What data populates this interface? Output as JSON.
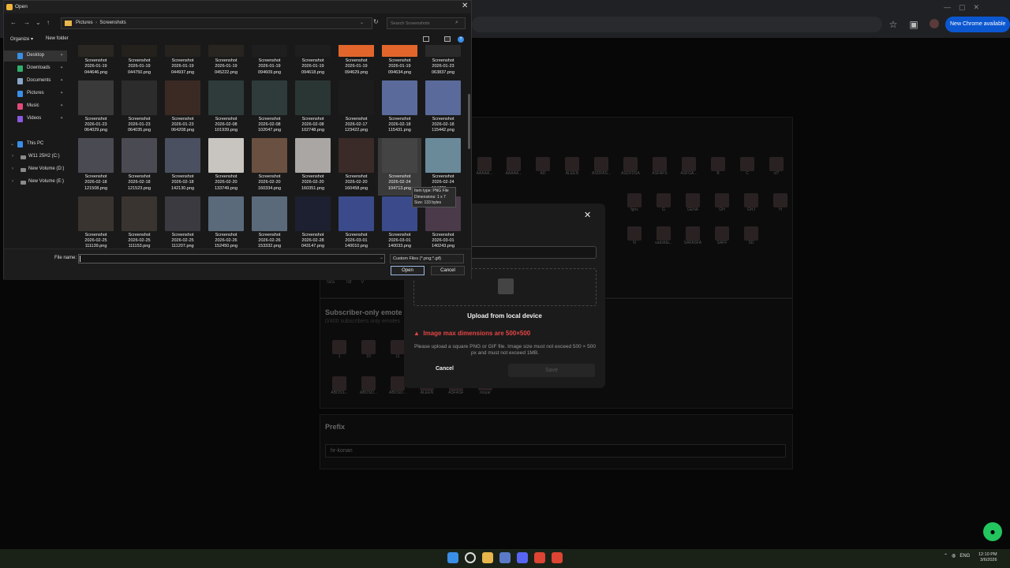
{
  "browser": {
    "new_chrome_label": "New Chrome available"
  },
  "page": {
    "subscriber_title": "Subscriber-only emote",
    "subscriber_note": "0/400 subscribers only emotes",
    "prefix_title": "Prefix",
    "prefix_value": "hr-konan",
    "emote_labels_row1": [
      "AAAAA...",
      "AAAAA...",
      "AD",
      "ALEEN",
      "ASDFAS...",
      "ASDFDSA",
      "ASFAFS",
      "ASFGA...",
      "B",
      "C",
      "cf7"
    ],
    "emote_labels_row2": [
      "fghs",
      "G",
      "GENA",
      "GH",
      "GHJ",
      "H"
    ],
    "emote_labels_row3": [
      "N",
      "sadsfda...",
      "SAFASFA",
      "SAFF",
      "SD"
    ],
    "emote_labels_row4": [
      "1",
      "10",
      "11",
      "3",
      "4",
      "5",
      "6",
      "7",
      "8"
    ],
    "emote_labels_row5": [
      "ABOSS...",
      "ABOSO...",
      "ABOSO...",
      "ALEEN",
      "ASFASF",
      "moyar"
    ],
    "partial_labels": [
      "fafa",
      "fdf",
      "V"
    ]
  },
  "modal": {
    "upload_title": "Upload from local device",
    "warning": "Image max dimensions are 500×500",
    "note": "Please upload a square PNG or GIF file. Image size must not exceed 500 × 500 px and must not exceed 1MB.",
    "cancel": "Cancel",
    "save": "Save"
  },
  "dialog": {
    "title": "Open",
    "path": [
      "Pictures",
      "Screenshots"
    ],
    "search_placeholder": "Search Screenshots",
    "organize": "Organize",
    "new_folder": "New folder",
    "sidebar": {
      "quick": [
        {
          "label": "Desktop",
          "icon": "desktop-icon",
          "color": "#3a8ee6"
        },
        {
          "label": "Downloads",
          "icon": "download-icon",
          "color": "#2fae6b"
        },
        {
          "label": "Documents",
          "icon": "document-icon",
          "color": "#8aa7c7"
        },
        {
          "label": "Pictures",
          "icon": "pictures-icon",
          "color": "#3a8ee6"
        },
        {
          "label": "Music",
          "icon": "music-icon",
          "color": "#e04a7a"
        },
        {
          "label": "Videos",
          "icon": "video-icon",
          "color": "#8a5ae0"
        }
      ],
      "this_pc": "This PC",
      "drives": [
        "W11 25H2 (C:)",
        "New Volume (D:)",
        "New Volume (E:)"
      ]
    },
    "files": [
      {
        "d": "2026-01-19",
        "t": "044646.png",
        "c": "#2a2622"
      },
      {
        "d": "2026-01-19",
        "t": "044750.png",
        "c": "#24201c"
      },
      {
        "d": "2026-01-19",
        "t": "044937.png",
        "c": "#26221e"
      },
      {
        "d": "2026-01-19",
        "t": "045222.png",
        "c": "#282420"
      },
      {
        "d": "2026-01-19",
        "t": "094609.png",
        "c": "#1e1e1e"
      },
      {
        "d": "2026-01-19",
        "t": "094618.png",
        "c": "#1e1e1e"
      },
      {
        "d": "2026-01-19",
        "t": "094629.png",
        "c": "#e2662c"
      },
      {
        "d": "2026-01-19",
        "t": "094634.png",
        "c": "#e2662c"
      },
      {
        "d": "2026-01-23",
        "t": "063837.png",
        "c": "#2a2a2a"
      },
      {
        "d": "2026-01-23",
        "t": "064029.png",
        "c": "#3a3a3a"
      },
      {
        "d": "2026-01-23",
        "t": "064035.png",
        "c": "#2c2c2c"
      },
      {
        "d": "2026-01-23",
        "t": "064208.png",
        "c": "#3b2a24"
      },
      {
        "d": "2026-02-08",
        "t": "101939.png",
        "c": "#2e3b3a"
      },
      {
        "d": "2026-02-08",
        "t": "102047.png",
        "c": "#2e3b3a"
      },
      {
        "d": "2026-02-08",
        "t": "102748.png",
        "c": "#2a3634"
      },
      {
        "d": "2026-02-17",
        "t": "123422.png",
        "c": "#1c1c1c"
      },
      {
        "d": "2026-02-18",
        "t": "115431.png",
        "c": "#5a6a9a"
      },
      {
        "d": "2026-02-18",
        "t": "115442.png",
        "c": "#5a6a9a"
      },
      {
        "d": "2026-02-18",
        "t": "121508.png",
        "c": "#4a4a52"
      },
      {
        "d": "2026-02-18",
        "t": "121523.png",
        "c": "#4a4a52"
      },
      {
        "d": "2026-02-18",
        "t": "142130.png",
        "c": "#4a5060"
      },
      {
        "d": "2026-02-20",
        "t": "133749.png",
        "c": "#c8c4c0"
      },
      {
        "d": "2026-02-20",
        "t": "160334.png",
        "c": "#6a5040"
      },
      {
        "d": "2026-02-20",
        "t": "160351.png",
        "c": "#aaa6a4"
      },
      {
        "d": "2026-02-20",
        "t": "160458.png",
        "c": "#3a2a28"
      },
      {
        "d": "2026-02-24",
        "t": "104713.png",
        "c": "#444444"
      },
      {
        "d": "2026-02-24",
        "t": "104720.png",
        "c": "#6a8a9a"
      },
      {
        "d": "2026-02-25",
        "t": "111139.png",
        "c": "#3a3430"
      },
      {
        "d": "2026-02-25",
        "t": "111153.png",
        "c": "#3a3430"
      },
      {
        "d": "2026-02-25",
        "t": "111207.png",
        "c": "#3a3a40"
      },
      {
        "d": "2026-02-26",
        "t": "152450.png",
        "c": "#5a6a7a"
      },
      {
        "d": "2026-02-26",
        "t": "153332.png",
        "c": "#5a6a7a"
      },
      {
        "d": "2026-02-28",
        "t": "043147.png",
        "c": "#1c2030"
      },
      {
        "d": "2026-03-01",
        "t": "140010.png",
        "c": "#3a4a8a"
      },
      {
        "d": "2026-03-01",
        "t": "140033.png",
        "c": "#3a4a8a"
      },
      {
        "d": "2026-03-01",
        "t": "140243.png",
        "c": "#4a3a4a"
      }
    ],
    "file_label": "Screenshot",
    "tooltip": [
      "Item type: PNG File",
      "Dimensions: 1 x 7",
      "Size: 133 bytes"
    ],
    "file_name_label": "File name:",
    "file_name_value": "",
    "file_type": "Custom Files (*.png;*.gif)",
    "open": "Open",
    "cancel": "Cancel"
  },
  "taskbar": {
    "lang": "ENG",
    "time": "12:10 PM",
    "date": "3/6/2026",
    "apps": [
      "start-icon",
      "search-icon",
      "file-explorer-icon",
      "store-icon",
      "discord-icon",
      "chrome-icon",
      "chrome-alt-icon"
    ]
  }
}
